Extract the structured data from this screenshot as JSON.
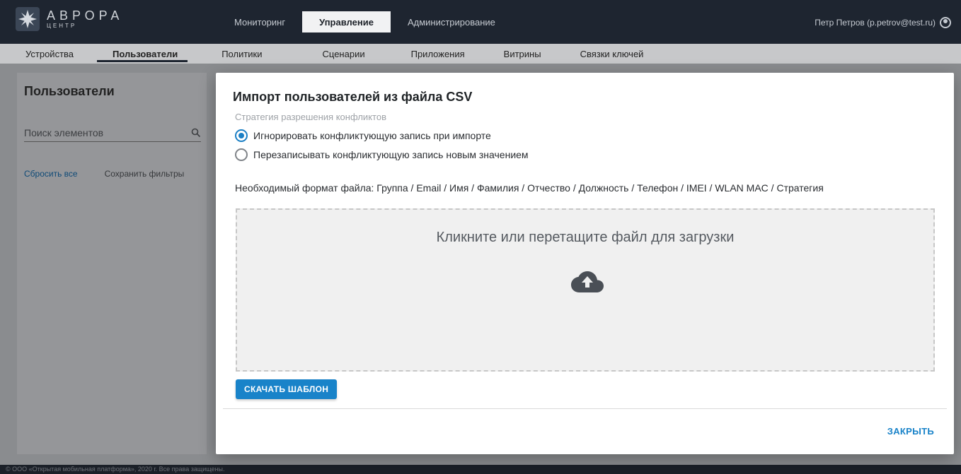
{
  "header": {
    "logo_name": "АВРОРА",
    "logo_sub": "ЦЕНТР",
    "tabs": [
      {
        "label": "Мониторинг"
      },
      {
        "label": "Управление"
      },
      {
        "label": "Администрирование"
      }
    ],
    "user_label": "Петр Петров (p.petrov@test.ru)"
  },
  "subnav": {
    "items": [
      {
        "label": "Устройства"
      },
      {
        "label": "Пользователи"
      },
      {
        "label": "Политики"
      },
      {
        "label": "Сценарии"
      },
      {
        "label": "Приложения"
      },
      {
        "label": "Витрины"
      },
      {
        "label": "Связки ключей"
      }
    ]
  },
  "left_panel": {
    "title": "Пользователи",
    "search_placeholder": "Поиск элементов",
    "reset_label": "Сбросить все",
    "save_filters_label": "Сохранить фильтры"
  },
  "modal": {
    "title": "Импорт пользователей из файла CSV",
    "strategy_label": "Стратегия разрешения конфликтов",
    "options": [
      {
        "label": "Игнорировать конфликтующую запись при импорте",
        "checked": true
      },
      {
        "label": "Перезаписывать конфликтующую запись новым значением",
        "checked": false
      }
    ],
    "format_text": "Необходимый формат файла: Группа / Email / Имя / Фамилия / Отчество / Должность / Телефон / IMEI / WLAN MAC / Стратегия",
    "dropzone_text": "Кликните или перетащите файл для загрузки",
    "download_label": "СКАЧАТЬ ШАБЛОН",
    "close_label": "ЗАКРЫТЬ"
  },
  "footer": {
    "text": "© ООО «Открытая мобильная платформа», 2020 г. Все права защищены."
  },
  "colors": {
    "accent": "#1983c9",
    "header_bg": "#1e2530"
  },
  "icons": {
    "logo": "aurora-logo-icon",
    "user": "user-circle-icon",
    "search": "search-icon",
    "upload": "cloud-upload-icon"
  }
}
